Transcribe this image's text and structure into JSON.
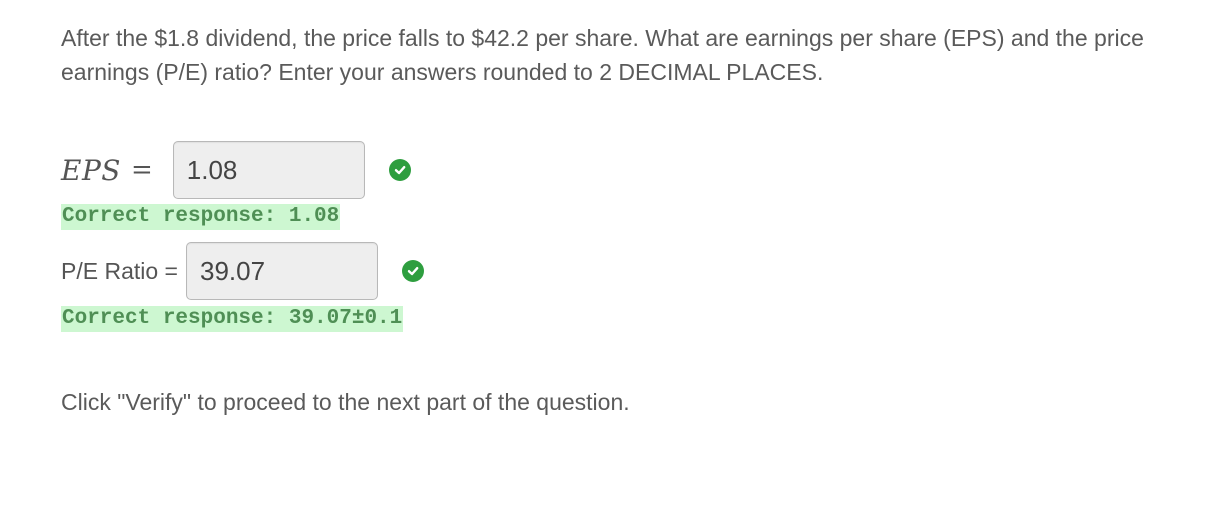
{
  "question": {
    "text": "After the $1.8 dividend, the price falls to $42.2 per share.  What are earnings per share (EPS) and the price earnings (P/E) ratio? Enter your answers rounded to 2 DECIMAL PLACES."
  },
  "eps": {
    "label": "EPS",
    "equals": "=",
    "value": "1.08",
    "status": "correct",
    "status_icon": "check-circle-icon",
    "feedback": "Correct response: 1.08"
  },
  "pe_ratio": {
    "label": "P/E Ratio =",
    "value": "39.07",
    "status": "correct",
    "status_icon": "check-circle-icon",
    "feedback": "Correct response: 39.07±0.1"
  },
  "instruction": {
    "text": "Click \"Verify\" to proceed to the next part of the question."
  },
  "colors": {
    "correct_icon": "#2e9e3f",
    "feedback_bg": "#cdf7d1",
    "feedback_text": "#4f8f55"
  }
}
